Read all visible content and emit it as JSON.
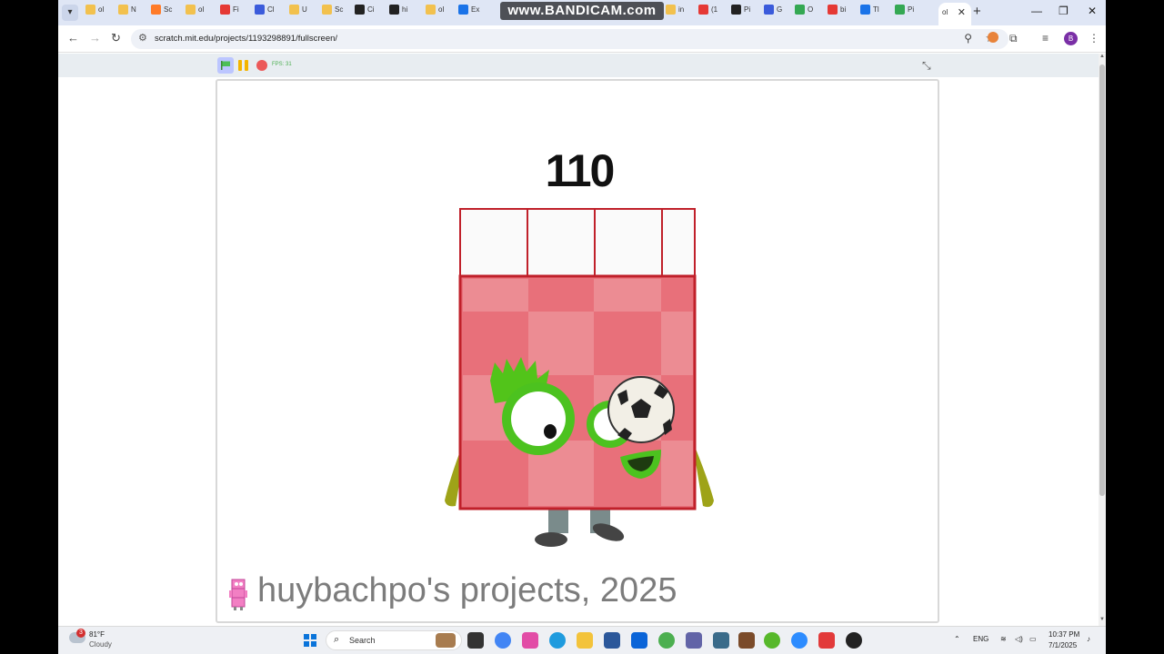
{
  "browser": {
    "tabs": [
      {
        "label": "ol",
        "favicon_color": "#f2c14e"
      },
      {
        "label": "N",
        "favicon_color": "#f2c14e"
      },
      {
        "label": "Sc",
        "favicon_color": "#ff7b29"
      },
      {
        "label": "ol",
        "favicon_color": "#f2c14e"
      },
      {
        "label": "Fi",
        "favicon_color": "#e53935"
      },
      {
        "label": "Cl",
        "favicon_color": "#3b5bdb"
      },
      {
        "label": "U",
        "favicon_color": "#f2c14e"
      },
      {
        "label": "Sc",
        "favicon_color": "#f2c14e"
      },
      {
        "label": "Ci",
        "favicon_color": "#222222"
      },
      {
        "label": "hi",
        "favicon_color": "#222222"
      },
      {
        "label": "ol",
        "favicon_color": "#f2c14e"
      },
      {
        "label": "Ex",
        "favicon_color": "#1a73e8"
      },
      {
        "label": "in",
        "favicon_color": "#f2c14e"
      },
      {
        "label": "(1",
        "favicon_color": "#e53935"
      },
      {
        "label": "Pi",
        "favicon_color": "#222222"
      },
      {
        "label": "G",
        "favicon_color": "#3b5bdb"
      },
      {
        "label": "O",
        "favicon_color": "#34a853"
      },
      {
        "label": "bi",
        "favicon_color": "#e53935"
      },
      {
        "label": "Tl",
        "favicon_color": "#1a73e8"
      },
      {
        "label": "Pi",
        "favicon_color": "#34a853"
      }
    ],
    "active_tab": {
      "label": "ol"
    },
    "recorder_watermark": "www.BANDICAM.com",
    "url": "scratch.mit.edu/projects/1193298891/fullscreen/",
    "profile_initial": "B"
  },
  "scratch": {
    "fps_label": "FPS: 31",
    "stage_number": "110",
    "credits_text": "huybachpo's projects, 2025"
  },
  "taskbar": {
    "weather_badge": "3",
    "weather_temp": "81°F",
    "weather_condition": "Cloudy",
    "search_label": "Search",
    "language": "ENG",
    "time": "10:37 PM",
    "date": "7/1/2025"
  }
}
